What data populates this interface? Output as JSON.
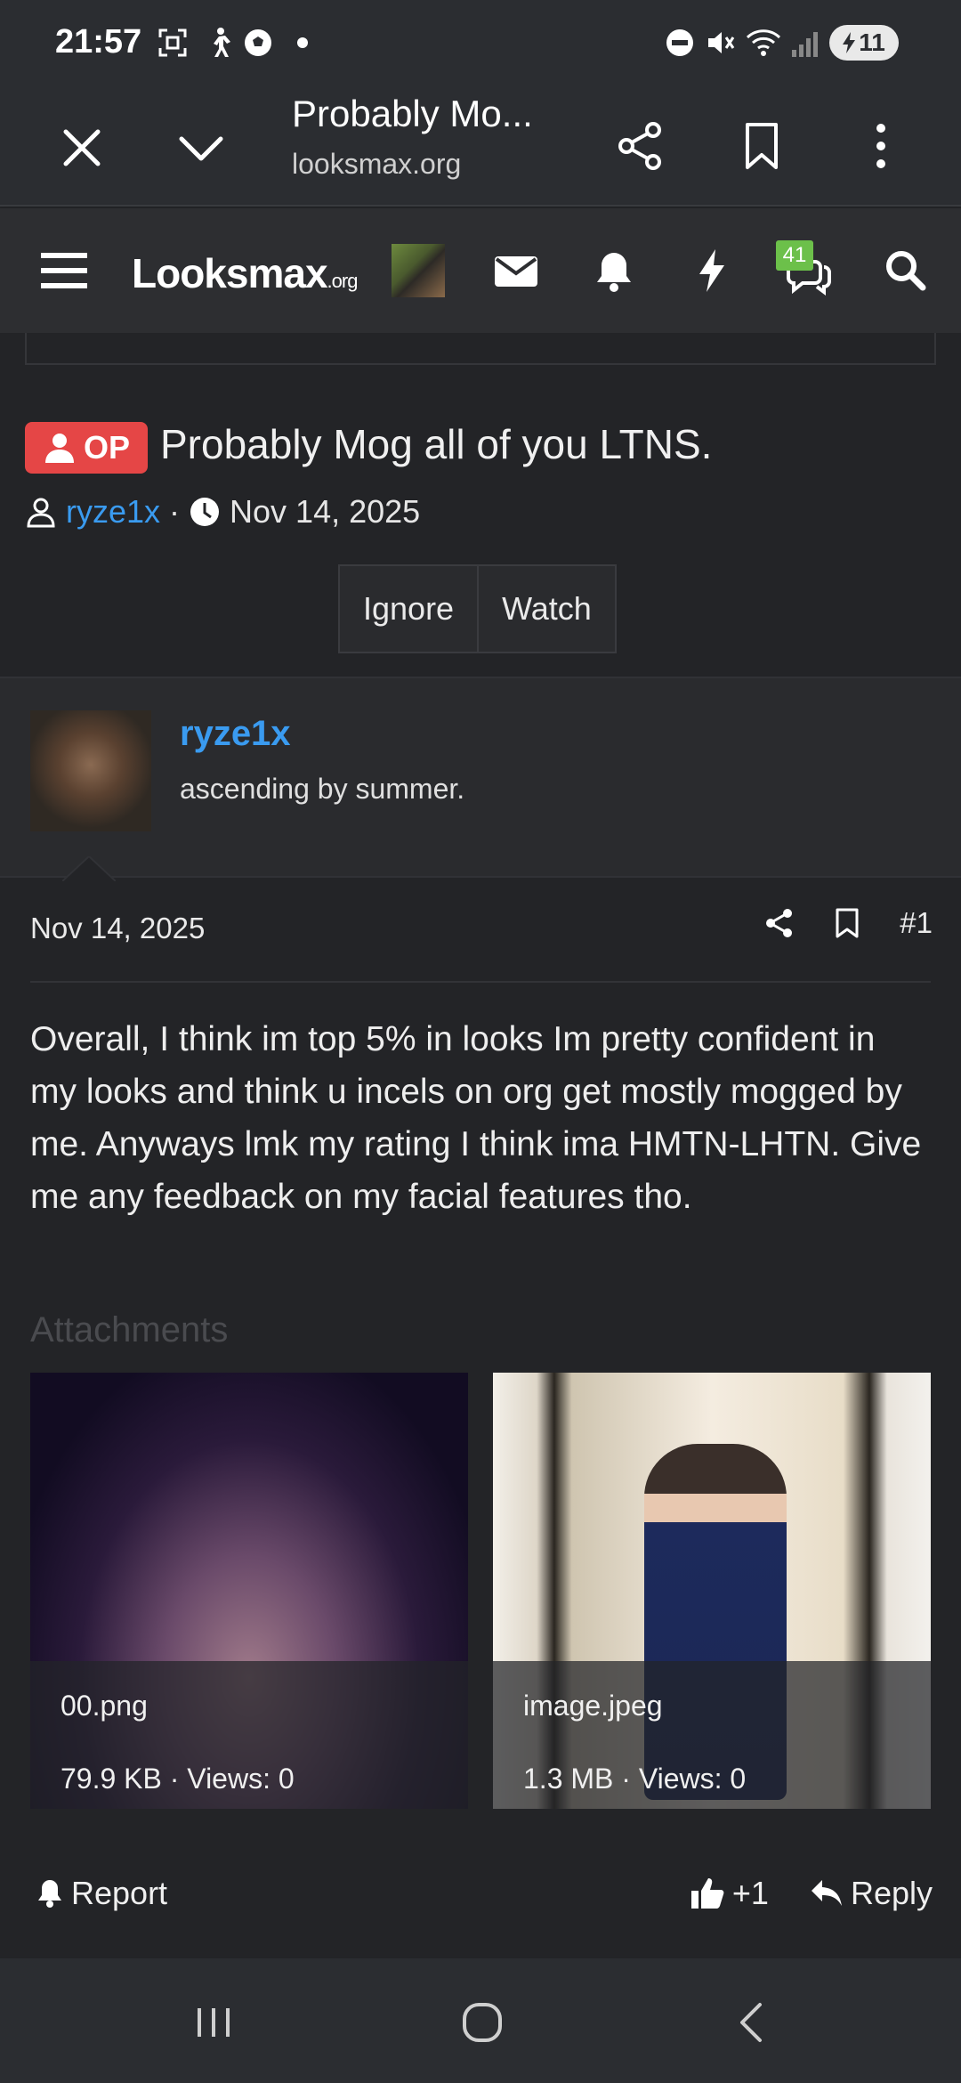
{
  "status_bar": {
    "time": "21:57",
    "battery": "11"
  },
  "browser": {
    "title": "Probably Mo...",
    "url": "looksmax.org"
  },
  "site_nav": {
    "logo_main": "Looksmax",
    "logo_suffix": ".org",
    "messages_badge": "41"
  },
  "thread": {
    "op_label": "OP",
    "title": "Probably Mog all of you LTNS.",
    "author": "ryze1x",
    "separator": "·",
    "date": "Nov 14, 2025",
    "buttons": [
      "Ignore",
      "Watch"
    ]
  },
  "user": {
    "name": "ryze1x",
    "title": "ascending by summer."
  },
  "post": {
    "date": "Nov 14, 2025",
    "number": "#1",
    "body": "Overall, I think im top 5% in looks Im pretty confident in my looks and think u incels on org get mostly mogged by me. Anyways lmk my rating I think ima HMTN-LHTN. Give me any feedback on my facial features tho.",
    "attachments_label": "Attachments",
    "attachments": [
      {
        "name": "00.png",
        "meta": "79.9 KB · Views: 0"
      },
      {
        "name": "image.jpeg",
        "meta": "1.3 MB · Views: 0"
      }
    ],
    "report_label": "Report",
    "plus_one_label": "+1",
    "reply_label": "Reply"
  },
  "colors": {
    "background": "#232427",
    "link": "#3a9bf0",
    "op_badge": "#e54646",
    "badge_green": "#6cc04a"
  }
}
